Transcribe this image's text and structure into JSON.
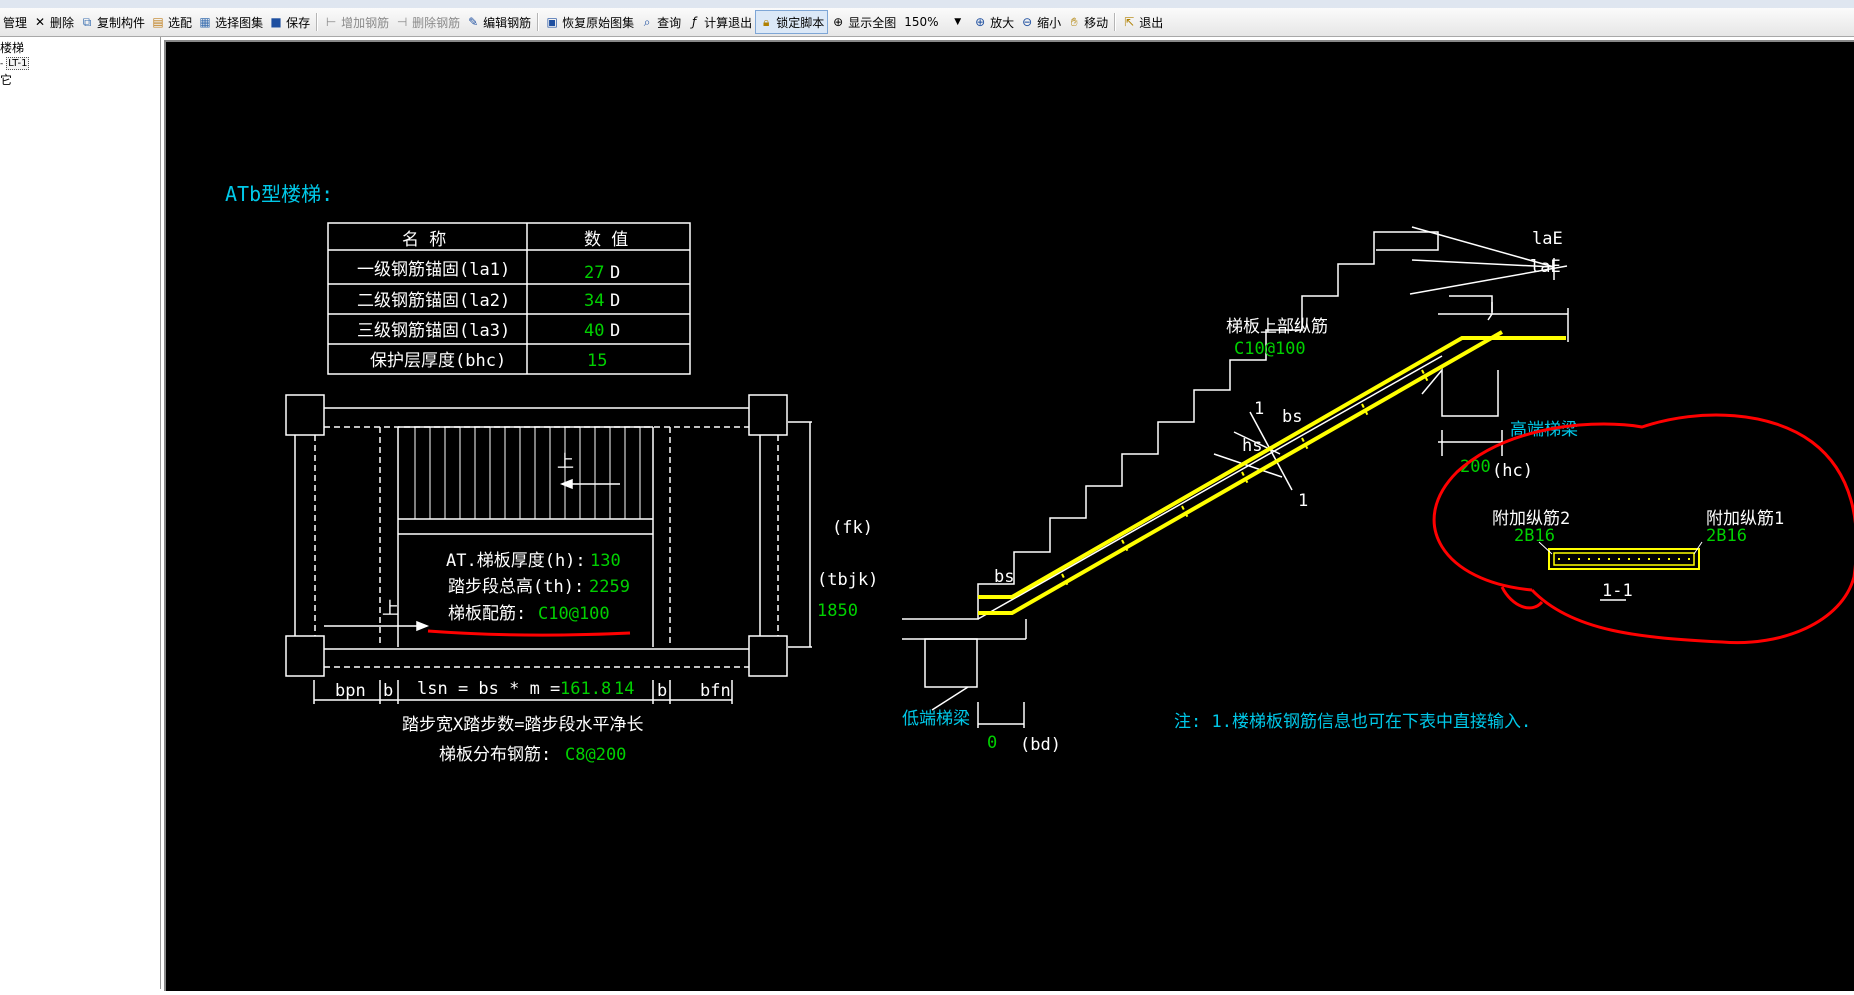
{
  "toolbar": {
    "items": [
      {
        "label": "管理",
        "icon": "manage-icon"
      },
      {
        "label": "删除",
        "icon": "delete-icon"
      },
      {
        "label": "复制构件",
        "icon": "copy-icon"
      },
      {
        "label": "选配",
        "icon": "select-config-icon"
      },
      {
        "label": "选择图集",
        "icon": "atlas-icon"
      },
      {
        "label": "保存",
        "icon": "save-icon"
      },
      {
        "label": "增加钢筋",
        "icon": "add-rebar-icon"
      },
      {
        "label": "删除钢筋",
        "icon": "remove-rebar-icon"
      },
      {
        "label": "编辑钢筋",
        "icon": "edit-rebar-icon"
      },
      {
        "label": "恢复原始图集",
        "icon": "restore-icon"
      },
      {
        "label": "查询",
        "icon": "query-icon"
      },
      {
        "label": "计算退出",
        "icon": "calc-exit-icon"
      },
      {
        "label": "锁定脚本",
        "icon": "lock-icon"
      },
      {
        "label": "显示全图",
        "icon": "fit-view-icon"
      },
      {
        "label": "放大",
        "icon": "zoom-in-icon"
      },
      {
        "label": "缩小",
        "icon": "zoom-out-icon"
      },
      {
        "label": "移动",
        "icon": "pan-icon"
      },
      {
        "label": "退出",
        "icon": "exit-icon"
      }
    ],
    "zoom": "150%"
  },
  "sidebar": {
    "items": [
      "楼梯",
      "LT-1",
      "它"
    ]
  },
  "drawing": {
    "title": "ATb型楼梯:",
    "table": {
      "headers": [
        "名  称",
        "数  值"
      ],
      "rows": [
        {
          "name": "一级钢筋锚固(la1)",
          "value": "27",
          "unit": "D"
        },
        {
          "name": "二级钢筋锚固(la2)",
          "value": "34",
          "unit": "D"
        },
        {
          "name": "三级钢筋锚固(la3)",
          "value": "40",
          "unit": "D"
        },
        {
          "name": "保护层厚度(bhc)",
          "value": "15",
          "unit": ""
        }
      ]
    },
    "plan": {
      "up1": "上",
      "up2": "上",
      "thickness_label": "AT.梯板厚度(h):",
      "thickness_value": "130",
      "height_label": "踏步段总高(th):",
      "height_value": "2259",
      "rebar_label": "梯板配筋:",
      "rebar_value": "C10@100",
      "fk": "(fk)",
      "tbjk": "(tbjk)",
      "tbjk_value": "1850",
      "bpn": "bpn",
      "b1": "b",
      "b2": "b",
      "bfn": "bfn",
      "lsn_label": "lsn = bs * m =",
      "lsn_value": "161.8",
      "m_value": "14",
      "formula": "踏步宽X踏步数=踏步段水平净长",
      "dist_label": "梯板分布钢筋:",
      "dist_value": "C8@200"
    },
    "section": {
      "upper_rebar_label": "梯板上部纵筋",
      "upper_rebar_value": "C10@100",
      "laE1": "laE",
      "laE2": "laE",
      "bs_top": "bs",
      "hs": "hs",
      "bs_bottom": "bs",
      "mark1": "1",
      "mark2": "1",
      "high_beam": "高端梯梁",
      "hc_value": "200",
      "hc_label": "(hc)",
      "low_beam": "低端梯梁",
      "bd_value": "0",
      "bd_label": "(bd)",
      "extra2_label": "附加纵筋2",
      "extra2_value": "2B16",
      "extra1_label": "附加纵筋1",
      "extra1_value": "2B16",
      "section_mark": "1-1",
      "note": "注: 1.楼梯板钢筋信息也可在下表中直接输入."
    }
  },
  "colors": {
    "canvas": "#000000",
    "line": "#ffffff",
    "value_green": "#00d000",
    "cyan": "#00c8e8",
    "rebar_yellow": "#ffff00",
    "markup_red": "#ff0000"
  }
}
